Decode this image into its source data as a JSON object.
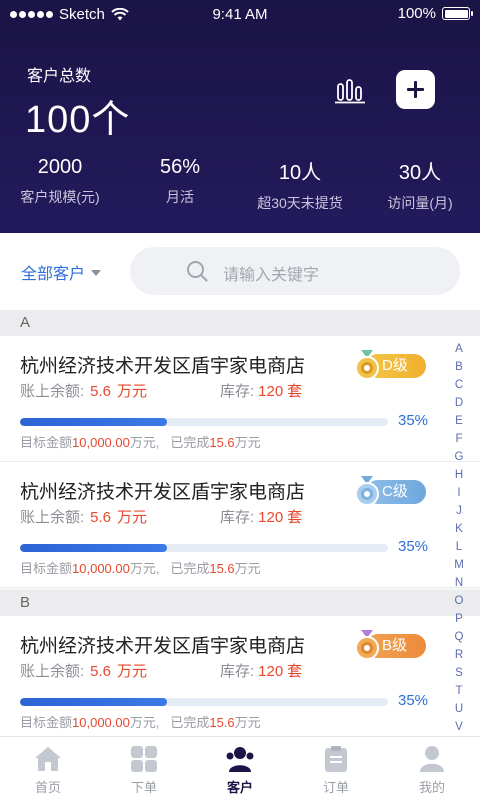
{
  "status_bar": {
    "carrier": "Sketch",
    "time": "9:41 AM",
    "battery": "100%"
  },
  "header": {
    "total_label": "客户总数",
    "total_value": "100个",
    "stats": [
      {
        "value": "2000",
        "label": "客户规模(元)"
      },
      {
        "value": "56%",
        "label": "月活"
      },
      {
        "value": "10人",
        "label": "超30天未提货"
      },
      {
        "value": "30人",
        "label": "访问量(月)"
      }
    ]
  },
  "filter": {
    "all_label": "全部客户",
    "search_placeholder": "请输入关键字"
  },
  "sections": [
    {
      "letter": "A"
    },
    {
      "letter": "B"
    }
  ],
  "cards": [
    {
      "name": "杭州经济技术开发区盾宇家电商店",
      "balance_label": "账上余额:",
      "balance": "5.6",
      "balance_unit": "万元",
      "stock_label": "库存:",
      "stock": "120",
      "stock_unit": "套",
      "level": "D级",
      "progress_pct": "35%",
      "progress": 0.4,
      "target_label": "目标金额",
      "target_value": "10,000.00",
      "target_unit": "万元,",
      "done_label": "已完成",
      "done_value": "15.6",
      "done_unit": "万元"
    },
    {
      "name": "杭州经济技术开发区盾宇家电商店",
      "balance_label": "账上余额:",
      "balance": "5.6",
      "balance_unit": "万元",
      "stock_label": "库存:",
      "stock": "120",
      "stock_unit": "套",
      "level": "C级",
      "progress_pct": "35%",
      "progress": 0.4,
      "target_label": "目标金额",
      "target_value": "10,000.00",
      "target_unit": "万元,",
      "done_label": "已完成",
      "done_value": "15.6",
      "done_unit": "万元"
    },
    {
      "name": "杭州经济技术开发区盾宇家电商店",
      "balance_label": "账上余额:",
      "balance": "5.6",
      "balance_unit": "万元",
      "stock_label": "库存:",
      "stock": "120",
      "stock_unit": "套",
      "level": "B级",
      "progress_pct": "35%",
      "progress": 0.4,
      "target_label": "目标金额",
      "target_value": "10,000.00",
      "target_unit": "万元,",
      "done_label": "已完成",
      "done_value": "15.6",
      "done_unit": "万元"
    }
  ],
  "alphabet": [
    "A",
    "B",
    "C",
    "D",
    "E",
    "F",
    "G",
    "H",
    "I",
    "J",
    "K",
    "L",
    "M",
    "N",
    "O",
    "P",
    "Q",
    "R",
    "S",
    "T",
    "U",
    "V"
  ],
  "tabs": [
    {
      "label": "首页",
      "icon": "home-icon"
    },
    {
      "label": "下单",
      "icon": "grid-icon"
    },
    {
      "label": "客户",
      "icon": "users-icon"
    },
    {
      "label": "订单",
      "icon": "clipboard-icon"
    },
    {
      "label": "我的",
      "icon": "person-icon"
    }
  ],
  "colors": {
    "header_bg": "#1b1446",
    "accent": "#2f6fd9",
    "highlight": "#e8492e",
    "level_d": "#f0b02f",
    "level_c": "#6ea7dd",
    "level_b": "#ec8a3b"
  }
}
